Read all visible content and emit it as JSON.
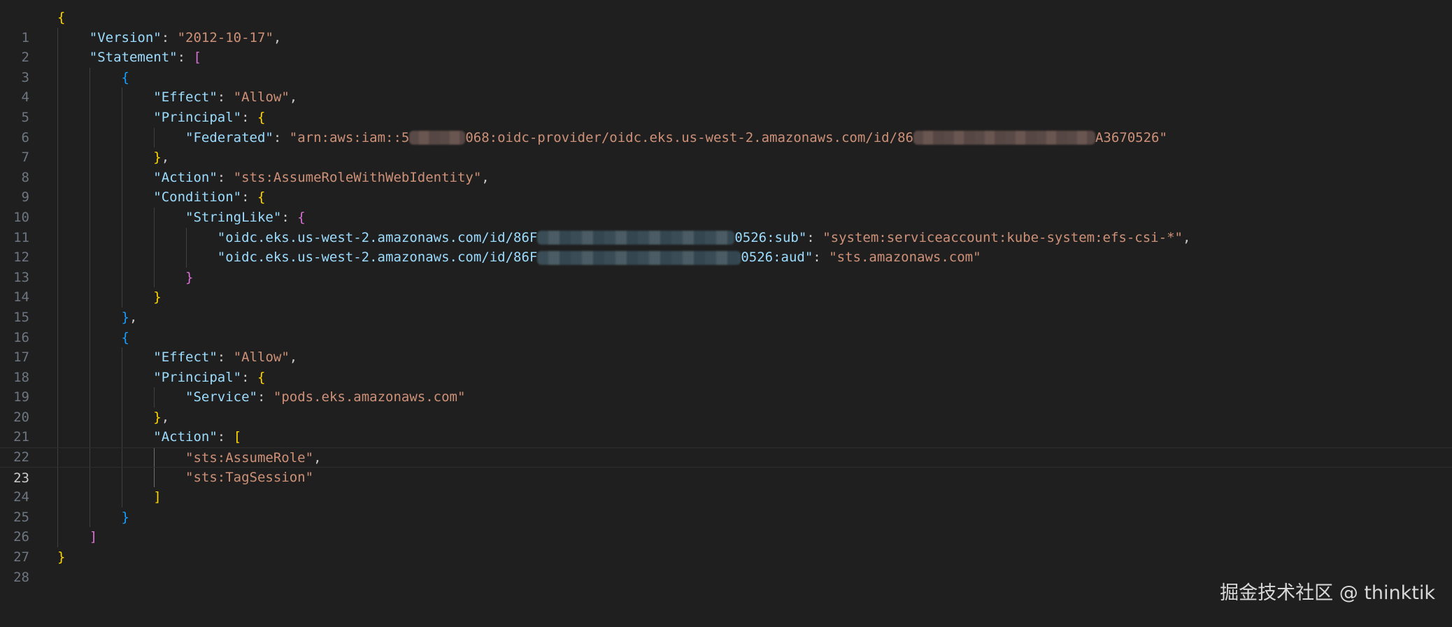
{
  "editor": {
    "line_numbers": [
      "1",
      "2",
      "3",
      "4",
      "5",
      "6",
      "7",
      "8",
      "9",
      "10",
      "11",
      "12",
      "13",
      "14",
      "15",
      "16",
      "17",
      "18",
      "19",
      "20",
      "21",
      "22",
      "23",
      "24",
      "25",
      "26",
      "27",
      "28"
    ],
    "current_line": "23",
    "tokens": {
      "open_brace": "{",
      "close_brace": "}",
      "open_bracket": "[",
      "close_bracket": "]",
      "comma": ",",
      "colon": ": ",
      "version_key": "\"Version\"",
      "version_val": "\"2012-10-17\"",
      "statement_key": "\"Statement\"",
      "effect_key": "\"Effect\"",
      "allow_val": "\"Allow\"",
      "principal_key": "\"Principal\"",
      "federated_key": "\"Federated\"",
      "federated_val_part1": "\"arn:aws:iam::5",
      "federated_val_part2": "068:oidc-provider/oidc.eks.us-west-2.amazonaws.com/id/86",
      "federated_val_part3": "A3670526\"",
      "action_key": "\"Action\"",
      "action_val": "\"sts:AssumeRoleWithWebIdentity\"",
      "condition_key": "\"Condition\"",
      "stringlike_key": "\"StringLike\"",
      "sub_key_part1": "\"oidc.eks.us-west-2.amazonaws.com/id/86F",
      "sub_key_part2": "0526:sub\"",
      "sub_val": "\"system:serviceaccount:kube-system:efs-csi-*\"",
      "aud_key_part1": "\"oidc.eks.us-west-2.amazonaws.com/id/86F",
      "aud_key_part2": "0526:aud\"",
      "aud_val": "\"sts.amazonaws.com\"",
      "service_key": "\"Service\"",
      "service_val": "\"pods.eks.amazonaws.com\"",
      "assume_role_val": "\"sts:AssumeRole\"",
      "tag_session_val": "\"sts:TagSession\""
    }
  },
  "watermark": "掘金技术社区 @ thinktik"
}
